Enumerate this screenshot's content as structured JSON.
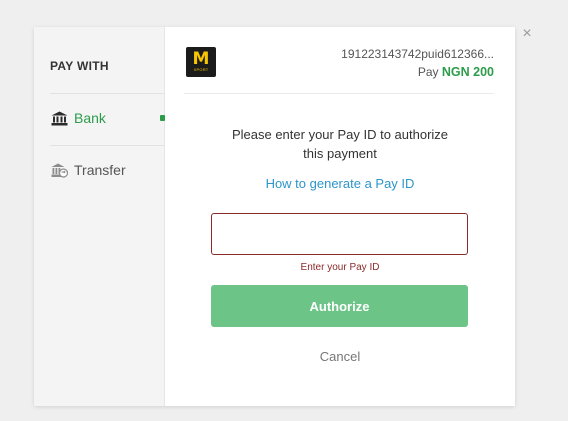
{
  "dialog": {
    "close_glyph": "×"
  },
  "sidebar": {
    "heading": "PAY WITH",
    "items": [
      {
        "label": "Bank",
        "icon": "bank-icon",
        "active": true
      },
      {
        "label": "Transfer",
        "icon": "transfer-icon",
        "active": false
      }
    ]
  },
  "header": {
    "logo_letter": "M",
    "logo_subtext": "XPORT",
    "reference": "191223143742puid612366...",
    "pay_label": "Pay",
    "amount": "NGN 200"
  },
  "form": {
    "prompt_line1": "Please enter your Pay ID to authorize",
    "prompt_line2": "this payment",
    "help_link": "How to generate a Pay ID",
    "input_value": "",
    "error": "Enter your Pay ID",
    "submit_label": "Authorize",
    "cancel_label": "Cancel"
  },
  "colors": {
    "accent_green": "#2c9c4b",
    "button_green": "#6cc487",
    "link_blue": "#2d95c9",
    "error_red": "#8a2b2b"
  }
}
